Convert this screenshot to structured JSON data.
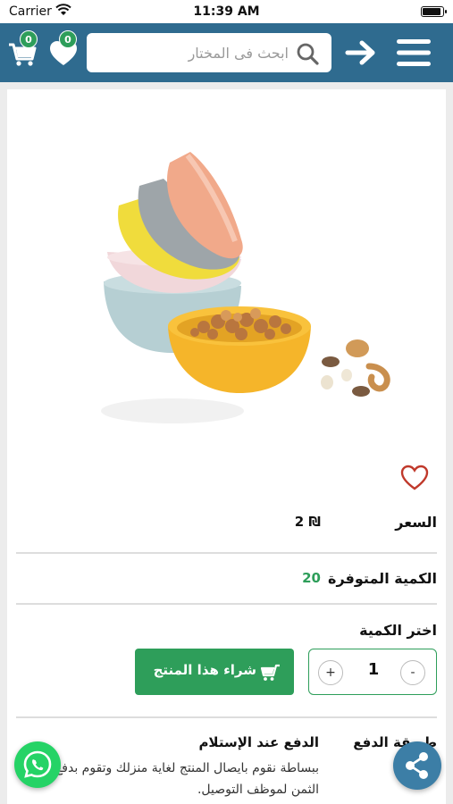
{
  "status_bar": {
    "carrier": "Carrier",
    "time": "11:39 AM"
  },
  "header": {
    "cart_count": "0",
    "wishlist_count": "0",
    "search_placeholder": "ابحث فى المختار"
  },
  "product": {
    "price_label": "السعر",
    "price_value": "2 ₪",
    "stock_label": "الكمية المتوفرة",
    "stock_value": "20",
    "quantity_label": "اختر الكمية",
    "quantity": "1",
    "buy_label": "شراء هذا المنتج",
    "payment_label": "طريقة الدفع",
    "payment_method": "الدفع عند الإستلام",
    "payment_description": "ببساطة نقوم بايصال المنتج لغاية منزلك وتقوم بدفع الثمن لموظف التوصيل."
  },
  "colors": {
    "header_bg": "#2f6b8f",
    "accent_green": "#2e9e5a",
    "whatsapp": "#25d366",
    "share": "#3c7ea6"
  },
  "icons": [
    "cart-icon",
    "heart-icon",
    "search-icon",
    "arrow-right-icon",
    "menu-icon",
    "favorite-heart-icon",
    "whatsapp-icon",
    "share-icon"
  ]
}
